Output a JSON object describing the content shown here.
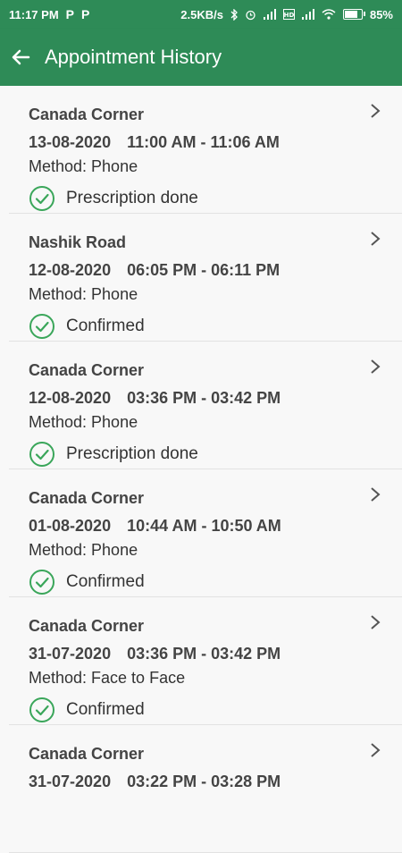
{
  "statusbar": {
    "time": "11:17 PM",
    "app_icons": [
      "P",
      "P"
    ],
    "speed": "2.5KB/s",
    "battery": "85%"
  },
  "appbar": {
    "title": "Appointment History"
  },
  "appointments": [
    {
      "location": "Canada Corner",
      "date": "13-08-2020",
      "time": "11:00 AM - 11:06 AM",
      "method": "Method: Phone",
      "status": "Prescription done"
    },
    {
      "location": "Nashik Road",
      "date": "12-08-2020",
      "time": "06:05 PM - 06:11 PM",
      "method": "Method: Phone",
      "status": "Confirmed"
    },
    {
      "location": "Canada Corner",
      "date": "12-08-2020",
      "time": "03:36 PM - 03:42 PM",
      "method": "Method: Phone",
      "status": "Prescription done"
    },
    {
      "location": "Canada Corner",
      "date": "01-08-2020",
      "time": "10:44 AM - 10:50 AM",
      "method": "Method: Phone",
      "status": "Confirmed"
    },
    {
      "location": "Canada Corner",
      "date": "31-07-2020",
      "time": "03:36 PM - 03:42 PM",
      "method": "Method: Face to Face",
      "status": "Confirmed"
    },
    {
      "location": "Canada Corner",
      "date": "31-07-2020",
      "time": "03:22 PM - 03:28 PM",
      "method": "",
      "status": ""
    }
  ],
  "colors": {
    "primary": "#2e8b57",
    "check": "#3aa65a"
  }
}
